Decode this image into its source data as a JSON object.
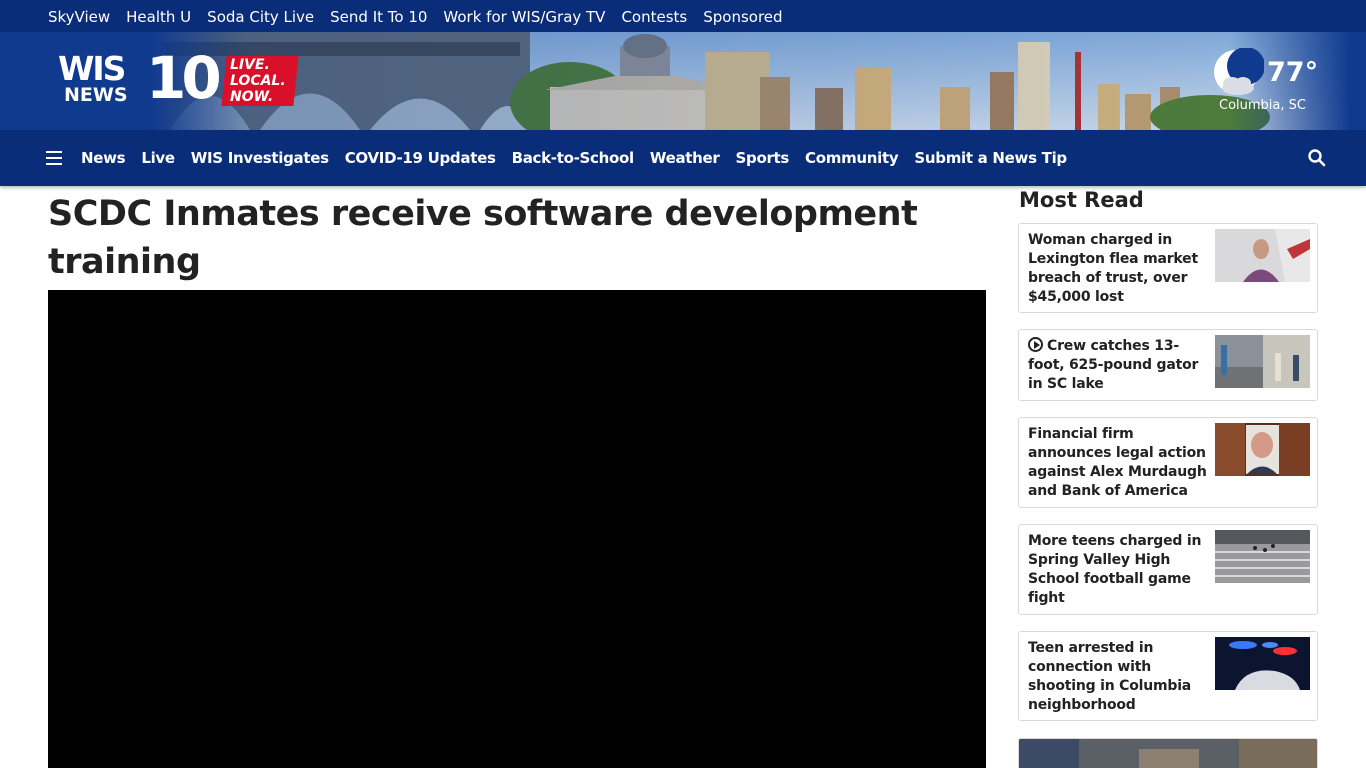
{
  "top_links": [
    "SkyView",
    "Health U",
    "Soda City Live",
    "Send It To 10",
    "Work for WIS/Gray TV",
    "Contests",
    "Sponsored"
  ],
  "logo": {
    "wis": "WIS",
    "news": "NEWS",
    "ten": "10",
    "tagline": "LIVE. LOCAL. NOW."
  },
  "weather": {
    "temp": "77°",
    "location": "Columbia, SC",
    "icon": "moon-cloud-icon"
  },
  "nav": [
    "News",
    "Live",
    "WIS Investigates",
    "COVID-19 Updates",
    "Back-to-School",
    "Weather",
    "Sports",
    "Community",
    "Submit a News Tip"
  ],
  "article": {
    "headline": "SCDC Inmates receive software development training"
  },
  "most_read": {
    "title": "Most Read",
    "items": [
      {
        "text": "Woman charged in Lexington flea market breach of trust, over $45,000 lost",
        "video": false
      },
      {
        "text": "Crew catches 13-foot, 625-pound gator in SC lake",
        "video": true
      },
      {
        "text": "Financial firm announces legal action against Alex Murdaugh and Bank of America",
        "video": false
      },
      {
        "text": "More teens charged in Spring Valley High School football game fight",
        "video": false
      },
      {
        "text": "Teen arrested in connection with shooting in Columbia neighborhood",
        "video": false
      }
    ]
  },
  "colors": {
    "nav_bg": "#0a2d7a",
    "banner_bg": "#103a8e",
    "accent_red": "#d8102a",
    "text": "#222222"
  }
}
